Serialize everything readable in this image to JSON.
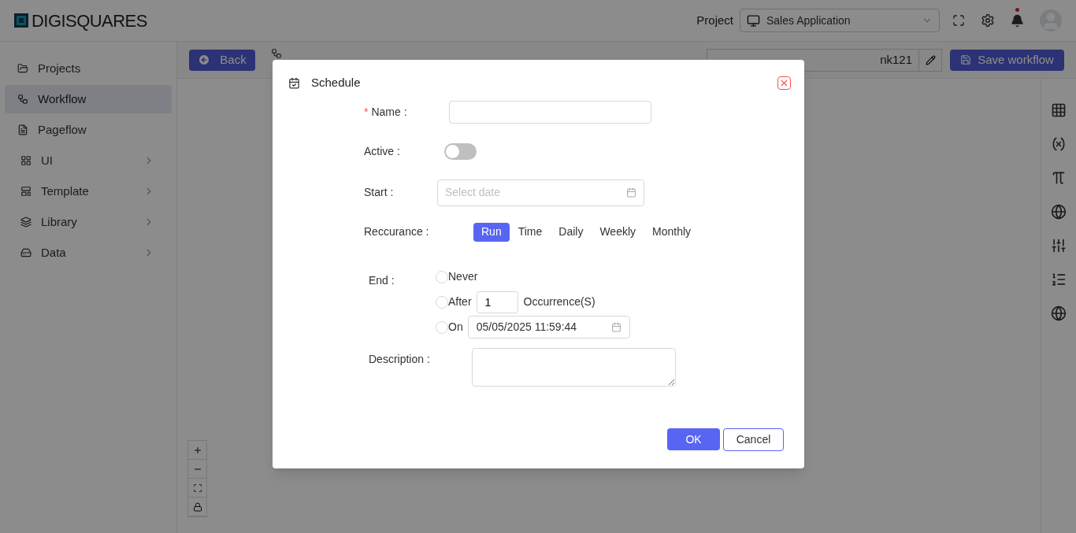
{
  "header": {
    "logo": "DIGISQUARES",
    "project_label": "Project",
    "project_select": "Sales Application",
    "notification_dot": true
  },
  "sidebar": {
    "items": [
      {
        "label": "Projects",
        "selected": false,
        "expandable": false
      },
      {
        "label": "Workflow",
        "selected": true,
        "expandable": false
      },
      {
        "label": "Pageflow",
        "selected": false,
        "expandable": false
      },
      {
        "label": "UI",
        "selected": false,
        "expandable": true
      },
      {
        "label": "Template",
        "selected": false,
        "expandable": true
      },
      {
        "label": "Library",
        "selected": false,
        "expandable": true
      },
      {
        "label": "Data",
        "selected": false,
        "expandable": true
      }
    ]
  },
  "toolbar": {
    "back": "Back",
    "name_value": "nk121",
    "save": "Save workflow"
  },
  "dialog": {
    "title": "Schedule",
    "name": {
      "label": "Name :",
      "required_mark": "*"
    },
    "active": {
      "label": "Active :",
      "on": false
    },
    "start": {
      "label": "Start :",
      "placeholder": "Select date"
    },
    "recurrence": {
      "label": "Reccurance :",
      "options": [
        {
          "label": "Run",
          "selected": true
        },
        {
          "label": "Time",
          "selected": false
        },
        {
          "label": "Daily",
          "selected": false
        },
        {
          "label": "Weekly",
          "selected": false
        },
        {
          "label": "Monthly",
          "selected": false
        }
      ]
    },
    "end": {
      "label": "End :",
      "options": [
        {
          "kind": "plain",
          "label": "Never",
          "selected": false
        },
        {
          "kind": "count",
          "label": "After",
          "value": "1",
          "suffix": "Occurrence(S)",
          "selected": false
        },
        {
          "kind": "date",
          "label": "On",
          "value": "05/05/2025 11:59:44",
          "selected": false
        }
      ]
    },
    "description": {
      "label": "Description :"
    },
    "ok": "OK",
    "cancel": "Cancel"
  }
}
